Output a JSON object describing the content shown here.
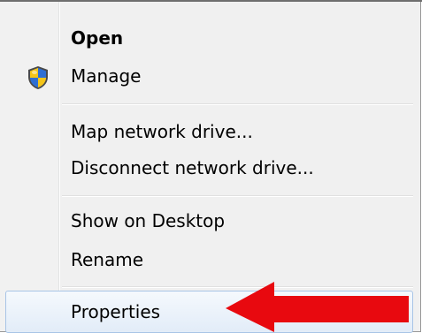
{
  "context_menu": {
    "items": [
      {
        "label": "Open",
        "bold": true,
        "icon": null
      },
      {
        "label": "Manage",
        "bold": false,
        "icon": "uac-shield-icon"
      },
      {
        "label": "Map network drive...",
        "bold": false,
        "icon": null
      },
      {
        "label": "Disconnect network drive...",
        "bold": false,
        "icon": null
      },
      {
        "label": "Show on Desktop",
        "bold": false,
        "icon": null
      },
      {
        "label": "Rename",
        "bold": false,
        "icon": null
      },
      {
        "label": "Properties",
        "bold": false,
        "icon": null,
        "highlighted": true
      }
    ]
  },
  "annotation": {
    "arrow_color": "#e8090f",
    "points_to": "Properties"
  },
  "colors": {
    "menu_background": "#f0f0f0",
    "highlight_border": "#a8c4e6",
    "highlight_fill": "#e2ecf8",
    "shield_blue": "#2f6fd3",
    "shield_yellow": "#f5c518"
  }
}
